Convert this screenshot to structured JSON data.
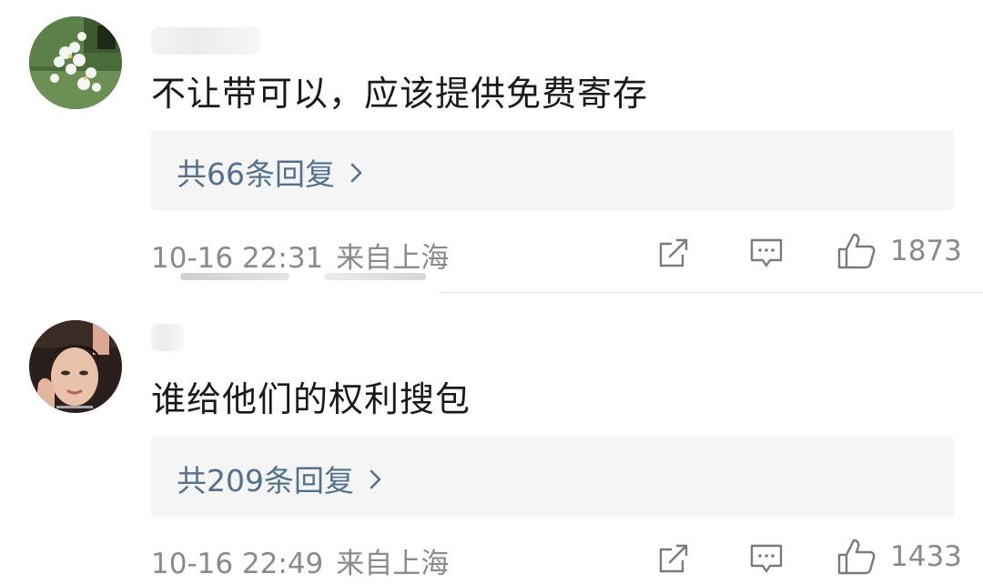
{
  "comments": [
    {
      "text": "不让带可以，应该提供免费寄存",
      "reply_summary": "共66条回复",
      "time": "10-16 22:31",
      "location": "来自上海",
      "likes": "1873",
      "icons": [
        "share-icon",
        "comment-icon",
        "like-icon",
        "chevron-right-icon"
      ]
    },
    {
      "text": "谁给他们的权利搜包",
      "reply_summary": "共209条回复",
      "time": "10-16 22:49",
      "location": "来自上海",
      "likes": "1433",
      "icons": [
        "share-icon",
        "comment-icon",
        "like-icon",
        "chevron-right-icon"
      ]
    }
  ],
  "colors": {
    "text": "#1a1a1a",
    "link": "#53718f",
    "meta": "#8a8a8a",
    "reply_bg": "#f5f5f5",
    "divider": "#e6e6e6"
  }
}
